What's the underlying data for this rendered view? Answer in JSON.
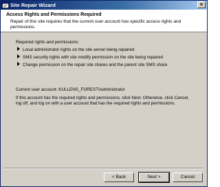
{
  "window": {
    "title": "Site Repair Wizard",
    "close_glyph": "×"
  },
  "header": {
    "title": "Access Rights and Permissions Required",
    "description": "Repair of this site requires that the current user account has specific access rights and permissions."
  },
  "main": {
    "requirements_heading": "Required rights and permissions:",
    "requirements": [
      "Local administrator rights on the site server being repaired",
      "SMS security rights with site modify permission on the site being repaired",
      "Change permission on the repair site shares and the parent site SMS share"
    ],
    "current_account": "Current user account: KULLENS_FOREST\\Administrator",
    "instructions": "If this account has the required rights and permissions, click Next. Otherwise, click Cancel, log off, and log on with a user account that has the required rights and permissions."
  },
  "buttons": {
    "back": "< Back",
    "next": "Next >",
    "cancel": "Cancel"
  },
  "icons": {
    "title_icon": "wizard-icon",
    "bullet_icon": "arrow-right-icon"
  },
  "colors": {
    "titlebar_start": "#0a246a",
    "titlebar_end": "#a6caf0",
    "dialog_face": "#d4d0c8",
    "header_bg": "#ffffff"
  }
}
